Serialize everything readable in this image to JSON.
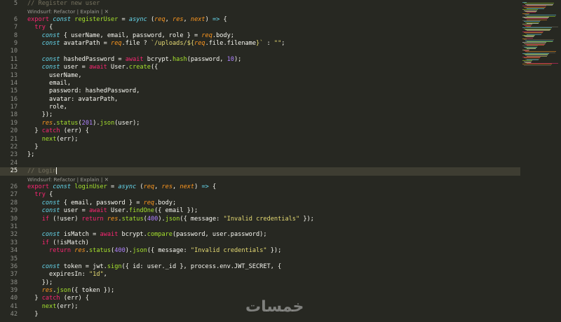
{
  "editor": {
    "codelens": {
      "text": "Windsurf: Refactor | Explain | ",
      "close": "✕"
    },
    "lines": [
      {
        "ln": "5",
        "tokens": [
          [
            "cmt",
            "// Register new user"
          ]
        ]
      },
      {
        "ln": "6",
        "tokens": [
          [
            "kw2",
            "export "
          ],
          [
            "kw",
            "const "
          ],
          [
            "fn",
            "registerUser"
          ],
          [
            "pun",
            " = "
          ],
          [
            "kw",
            "async "
          ],
          [
            "pun",
            "("
          ],
          [
            "param",
            "req"
          ],
          [
            "pun",
            ", "
          ],
          [
            "param",
            "res"
          ],
          [
            "pun",
            ", "
          ],
          [
            "param",
            "next"
          ],
          [
            "pun",
            ") "
          ],
          [
            "kw",
            "=> "
          ],
          [
            "pun",
            "{"
          ]
        ]
      },
      {
        "ln": "7",
        "tokens": [
          [
            "pun",
            "  "
          ],
          [
            "kw2",
            "try "
          ],
          [
            "pun",
            "{"
          ]
        ]
      },
      {
        "ln": "8",
        "tokens": [
          [
            "pun",
            "    "
          ],
          [
            "kw",
            "const "
          ],
          [
            "pun",
            "{ userName, email, password, role } = "
          ],
          [
            "param",
            "req"
          ],
          [
            "pun",
            ".body;"
          ]
        ]
      },
      {
        "ln": "9",
        "tokens": [
          [
            "pun",
            "    "
          ],
          [
            "kw",
            "const "
          ],
          [
            "pun",
            "avatarPath = "
          ],
          [
            "param",
            "req"
          ],
          [
            "pun",
            ".file ? "
          ],
          [
            "str",
            "`/uploads/${"
          ],
          [
            "param",
            "req"
          ],
          [
            "pun",
            ".file.filename"
          ],
          [
            "str",
            "}`"
          ],
          [
            "pun",
            " : "
          ],
          [
            "str",
            "\"\""
          ],
          [
            "pun",
            ";"
          ]
        ]
      },
      {
        "ln": "10",
        "tokens": [
          [
            "pun",
            ""
          ]
        ]
      },
      {
        "ln": "11",
        "tokens": [
          [
            "pun",
            "    "
          ],
          [
            "kw",
            "const "
          ],
          [
            "pun",
            "hashedPassword = "
          ],
          [
            "kw2",
            "await "
          ],
          [
            "pun",
            "bcrypt."
          ],
          [
            "fn",
            "hash"
          ],
          [
            "pun",
            "(password, "
          ],
          [
            "num",
            "10"
          ],
          [
            "pun",
            ");"
          ]
        ]
      },
      {
        "ln": "12",
        "tokens": [
          [
            "pun",
            "    "
          ],
          [
            "kw",
            "const "
          ],
          [
            "pun",
            "user = "
          ],
          [
            "kw2",
            "await "
          ],
          [
            "pun",
            "User."
          ],
          [
            "fn",
            "create"
          ],
          [
            "pun",
            "({"
          ]
        ]
      },
      {
        "ln": "13",
        "tokens": [
          [
            "pun",
            "      userName,"
          ]
        ]
      },
      {
        "ln": "14",
        "tokens": [
          [
            "pun",
            "      email,"
          ]
        ]
      },
      {
        "ln": "15",
        "tokens": [
          [
            "pun",
            "      password: hashedPassword,"
          ]
        ]
      },
      {
        "ln": "16",
        "tokens": [
          [
            "pun",
            "      avatar: avatarPath,"
          ]
        ]
      },
      {
        "ln": "17",
        "tokens": [
          [
            "pun",
            "      role,"
          ]
        ]
      },
      {
        "ln": "18",
        "tokens": [
          [
            "pun",
            "    });"
          ]
        ]
      },
      {
        "ln": "19",
        "tokens": [
          [
            "pun",
            "    "
          ],
          [
            "param",
            "res"
          ],
          [
            "pun",
            "."
          ],
          [
            "fn",
            "status"
          ],
          [
            "pun",
            "("
          ],
          [
            "num",
            "201"
          ],
          [
            "pun",
            ")."
          ],
          [
            "fn",
            "json"
          ],
          [
            "pun",
            "(user);"
          ]
        ]
      },
      {
        "ln": "20",
        "tokens": [
          [
            "pun",
            "  } "
          ],
          [
            "kw2",
            "catch "
          ],
          [
            "pun",
            "(err) {"
          ]
        ]
      },
      {
        "ln": "21",
        "tokens": [
          [
            "pun",
            "    "
          ],
          [
            "fn",
            "next"
          ],
          [
            "pun",
            "(err);"
          ]
        ]
      },
      {
        "ln": "22",
        "tokens": [
          [
            "pun",
            "  }"
          ]
        ]
      },
      {
        "ln": "23",
        "tokens": [
          [
            "pun",
            "};"
          ]
        ]
      },
      {
        "ln": "24",
        "tokens": [
          [
            "pun",
            ""
          ]
        ]
      },
      {
        "ln": "25",
        "tokens": [
          [
            "cmt",
            "// Login"
          ]
        ]
      },
      {
        "ln": "26",
        "tokens": [
          [
            "kw2",
            "export "
          ],
          [
            "kw",
            "const "
          ],
          [
            "fn",
            "loginUser"
          ],
          [
            "pun",
            " = "
          ],
          [
            "kw",
            "async "
          ],
          [
            "pun",
            "("
          ],
          [
            "param",
            "req"
          ],
          [
            "pun",
            ", "
          ],
          [
            "param",
            "res"
          ],
          [
            "pun",
            ", "
          ],
          [
            "param",
            "next"
          ],
          [
            "pun",
            ") "
          ],
          [
            "kw",
            "=> "
          ],
          [
            "pun",
            "{"
          ]
        ]
      },
      {
        "ln": "27",
        "tokens": [
          [
            "pun",
            "  "
          ],
          [
            "kw2",
            "try "
          ],
          [
            "pun",
            "{"
          ]
        ]
      },
      {
        "ln": "28",
        "tokens": [
          [
            "pun",
            "    "
          ],
          [
            "kw",
            "const "
          ],
          [
            "pun",
            "{ email, password } = "
          ],
          [
            "param",
            "req"
          ],
          [
            "pun",
            ".body;"
          ]
        ]
      },
      {
        "ln": "29",
        "tokens": [
          [
            "pun",
            "    "
          ],
          [
            "kw",
            "const "
          ],
          [
            "pun",
            "user = "
          ],
          [
            "kw2",
            "await "
          ],
          [
            "pun",
            "User."
          ],
          [
            "fn",
            "findOne"
          ],
          [
            "pun",
            "({ email });"
          ]
        ]
      },
      {
        "ln": "30",
        "tokens": [
          [
            "pun",
            "    "
          ],
          [
            "kw2",
            "if "
          ],
          [
            "pun",
            "(!user) "
          ],
          [
            "kw2",
            "return "
          ],
          [
            "param",
            "res"
          ],
          [
            "pun",
            "."
          ],
          [
            "fn",
            "status"
          ],
          [
            "pun",
            "("
          ],
          [
            "num",
            "400"
          ],
          [
            "pun",
            ")."
          ],
          [
            "fn",
            "json"
          ],
          [
            "pun",
            "({ message: "
          ],
          [
            "str",
            "\"Invalid credentials\""
          ],
          [
            "pun",
            " });"
          ]
        ]
      },
      {
        "ln": "31",
        "tokens": [
          [
            "pun",
            ""
          ]
        ]
      },
      {
        "ln": "32",
        "tokens": [
          [
            "pun",
            "    "
          ],
          [
            "kw",
            "const "
          ],
          [
            "pun",
            "isMatch = "
          ],
          [
            "kw2",
            "await "
          ],
          [
            "pun",
            "bcrypt."
          ],
          [
            "fn",
            "compare"
          ],
          [
            "pun",
            "(password, user.password);"
          ]
        ]
      },
      {
        "ln": "33",
        "tokens": [
          [
            "pun",
            "    "
          ],
          [
            "kw2",
            "if "
          ],
          [
            "pun",
            "(!isMatch)"
          ]
        ]
      },
      {
        "ln": "34",
        "tokens": [
          [
            "pun",
            "      "
          ],
          [
            "kw2",
            "return "
          ],
          [
            "param",
            "res"
          ],
          [
            "pun",
            "."
          ],
          [
            "fn",
            "status"
          ],
          [
            "pun",
            "("
          ],
          [
            "num",
            "400"
          ],
          [
            "pun",
            ")."
          ],
          [
            "fn",
            "json"
          ],
          [
            "pun",
            "({ message: "
          ],
          [
            "str",
            "\"Invalid credentials\""
          ],
          [
            "pun",
            " });"
          ]
        ]
      },
      {
        "ln": "35",
        "tokens": [
          [
            "pun",
            ""
          ]
        ]
      },
      {
        "ln": "36",
        "tokens": [
          [
            "pun",
            "    "
          ],
          [
            "kw",
            "const "
          ],
          [
            "pun",
            "token = jwt."
          ],
          [
            "fn",
            "sign"
          ],
          [
            "pun",
            "({ id: user._id }, process.env.JWT_SECRET, {"
          ]
        ]
      },
      {
        "ln": "37",
        "tokens": [
          [
            "pun",
            "      expiresIn: "
          ],
          [
            "str",
            "\"1d\""
          ],
          [
            "pun",
            ","
          ]
        ]
      },
      {
        "ln": "38",
        "tokens": [
          [
            "pun",
            "    });"
          ]
        ]
      },
      {
        "ln": "39",
        "tokens": [
          [
            "pun",
            "    "
          ],
          [
            "param",
            "res"
          ],
          [
            "pun",
            "."
          ],
          [
            "fn",
            "json"
          ],
          [
            "pun",
            "({ token });"
          ]
        ]
      },
      {
        "ln": "40",
        "tokens": [
          [
            "pun",
            "  } "
          ],
          [
            "kw2",
            "catch "
          ],
          [
            "pun",
            "(err) {"
          ]
        ]
      },
      {
        "ln": "41",
        "tokens": [
          [
            "pun",
            "    "
          ],
          [
            "fn",
            "next"
          ],
          [
            "pun",
            "(err);"
          ]
        ]
      },
      {
        "ln": "42",
        "tokens": [
          [
            "pun",
            "  }"
          ]
        ]
      }
    ]
  },
  "watermark": "خمسات",
  "colors": {
    "background": "#272822",
    "keyword": "#66d9ef",
    "control": "#f92672",
    "function": "#a6e22e",
    "string": "#e6db74",
    "number": "#ae81ff",
    "parameter": "#fd971f",
    "comment": "#75715e",
    "line_highlight": "#3e3d32"
  }
}
